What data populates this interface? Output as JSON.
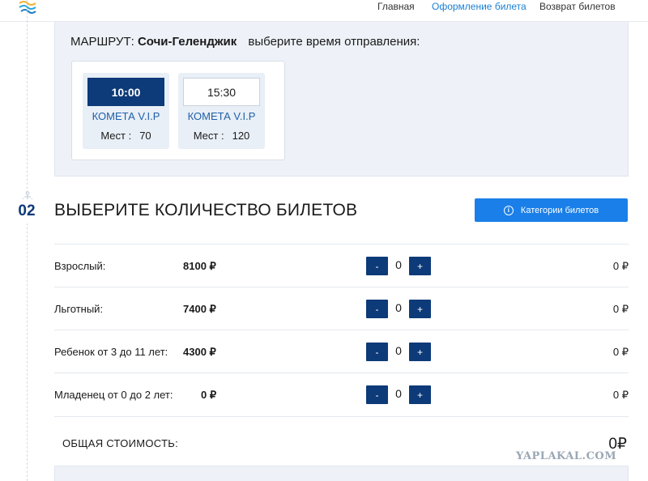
{
  "nav": {
    "items": [
      {
        "label": "Главная",
        "active": false
      },
      {
        "label": "Оформление билета",
        "active": true
      },
      {
        "label": "Возврат билетов",
        "active": false
      }
    ]
  },
  "route": {
    "prefix": "МАРШРУТ:",
    "name": "Сочи-Геленджик",
    "hint": "выберите время отправления:"
  },
  "trips": [
    {
      "time": "10:00",
      "vessel": "КОМЕТА V.I.P",
      "seats_label": "Мест :",
      "seats": "70",
      "selected": true
    },
    {
      "time": "15:30",
      "vessel": "КОМЕТА V.I.P",
      "seats_label": "Мест :",
      "seats": "120",
      "selected": false
    }
  ],
  "step": {
    "number": "02",
    "title": "ВЫБЕРИТЕ КОЛИЧЕСТВО БИЛЕТОВ",
    "categories_button": "Категории билетов"
  },
  "tickets": [
    {
      "label": "Взрослый:",
      "price": "8100 ₽",
      "minus": "-",
      "qty": "0",
      "plus": "+",
      "sum": "0 ₽"
    },
    {
      "label": "Льготный:",
      "price": "7400 ₽",
      "minus": "-",
      "qty": "0",
      "plus": "+",
      "sum": "0 ₽"
    },
    {
      "label": "Ребенок от 3 до 11 лет:",
      "price": "4300 ₽",
      "minus": "-",
      "qty": "0",
      "plus": "+",
      "sum": "0 ₽"
    },
    {
      "label": "Младенец от 0 до 2 лет:",
      "price": "0 ₽",
      "minus": "-",
      "qty": "0",
      "plus": "+",
      "sum": "0 ₽"
    }
  ],
  "total": {
    "label": "ОБЩАЯ СТОИМОСТЬ:",
    "value": "0₽"
  },
  "watermark": "YAPLAKAL.COM",
  "colors": {
    "accent": "#1a7fe8",
    "navy": "#0d3a78",
    "panel": "#eef2f8",
    "link_active": "#1a7fd6"
  }
}
